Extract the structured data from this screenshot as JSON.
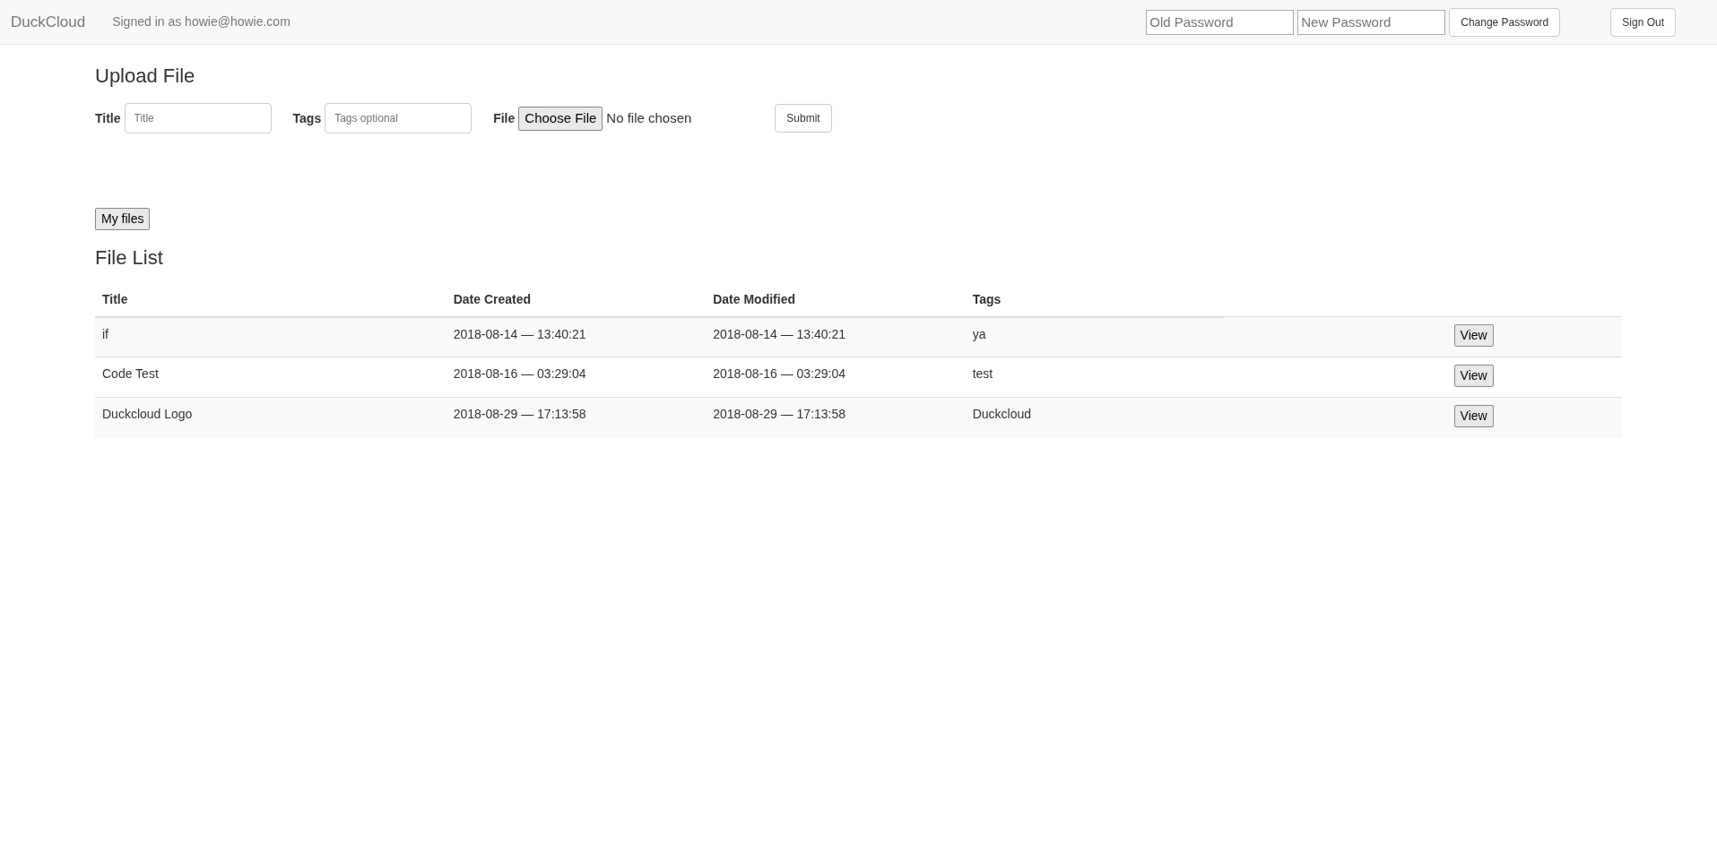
{
  "navbar": {
    "brand": "DuckCloud",
    "signed_in": "Signed in as howie@howie.com",
    "old_password": {
      "placeholder": "Old Password"
    },
    "new_password": {
      "placeholder": "New Password"
    },
    "change_button": "Change Password",
    "sign_out_button": "Sign Out"
  },
  "upload": {
    "heading": "Upload File",
    "title_label": "Title",
    "title_field": {
      "placeholder": "Title"
    },
    "tags_label": "Tags",
    "tags_field": {
      "placeholder": "Tags optional"
    },
    "file_label": "File",
    "choose_button": "Choose File",
    "file_status": "No file chosen",
    "submit_button": "Submit"
  },
  "my_files_button": "My files",
  "file_list": {
    "heading": "File List",
    "columns": [
      "Title",
      "Date Created",
      "Date Modified",
      "Tags"
    ],
    "rows": [
      {
        "cells": [
          "if",
          "2018-08-14 — 13:40:21",
          "2018-08-14 — 13:40:21",
          "ya"
        ],
        "action": "View"
      },
      {
        "cells": [
          "Code Test",
          "2018-08-16 — 03:29:04",
          "2018-08-16 — 03:29:04",
          "test"
        ],
        "action": "View"
      },
      {
        "cells": [
          "Duckcloud Logo",
          "2018-08-29 — 17:13:58",
          "2018-08-29 — 17:13:58",
          "Duckcloud"
        ],
        "action": "View"
      }
    ]
  }
}
